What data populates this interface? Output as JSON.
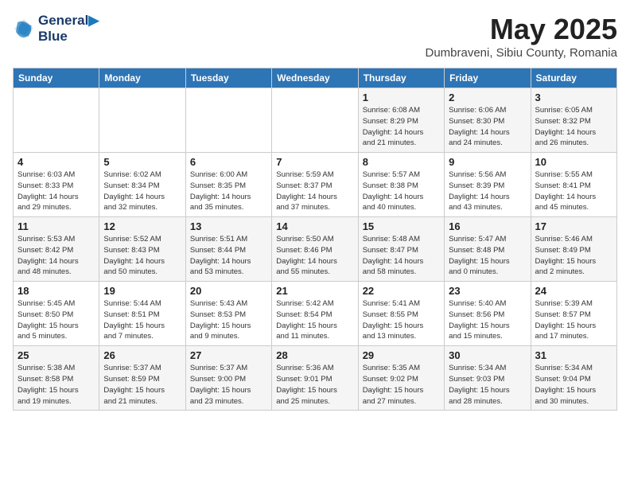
{
  "header": {
    "logo_line1": "General",
    "logo_line2": "Blue",
    "month": "May 2025",
    "location": "Dumbraveni, Sibiu County, Romania"
  },
  "weekdays": [
    "Sunday",
    "Monday",
    "Tuesday",
    "Wednesday",
    "Thursday",
    "Friday",
    "Saturday"
  ],
  "weeks": [
    [
      {
        "day": "",
        "info": ""
      },
      {
        "day": "",
        "info": ""
      },
      {
        "day": "",
        "info": ""
      },
      {
        "day": "",
        "info": ""
      },
      {
        "day": "1",
        "info": "Sunrise: 6:08 AM\nSunset: 8:29 PM\nDaylight: 14 hours\nand 21 minutes."
      },
      {
        "day": "2",
        "info": "Sunrise: 6:06 AM\nSunset: 8:30 PM\nDaylight: 14 hours\nand 24 minutes."
      },
      {
        "day": "3",
        "info": "Sunrise: 6:05 AM\nSunset: 8:32 PM\nDaylight: 14 hours\nand 26 minutes."
      }
    ],
    [
      {
        "day": "4",
        "info": "Sunrise: 6:03 AM\nSunset: 8:33 PM\nDaylight: 14 hours\nand 29 minutes."
      },
      {
        "day": "5",
        "info": "Sunrise: 6:02 AM\nSunset: 8:34 PM\nDaylight: 14 hours\nand 32 minutes."
      },
      {
        "day": "6",
        "info": "Sunrise: 6:00 AM\nSunset: 8:35 PM\nDaylight: 14 hours\nand 35 minutes."
      },
      {
        "day": "7",
        "info": "Sunrise: 5:59 AM\nSunset: 8:37 PM\nDaylight: 14 hours\nand 37 minutes."
      },
      {
        "day": "8",
        "info": "Sunrise: 5:57 AM\nSunset: 8:38 PM\nDaylight: 14 hours\nand 40 minutes."
      },
      {
        "day": "9",
        "info": "Sunrise: 5:56 AM\nSunset: 8:39 PM\nDaylight: 14 hours\nand 43 minutes."
      },
      {
        "day": "10",
        "info": "Sunrise: 5:55 AM\nSunset: 8:41 PM\nDaylight: 14 hours\nand 45 minutes."
      }
    ],
    [
      {
        "day": "11",
        "info": "Sunrise: 5:53 AM\nSunset: 8:42 PM\nDaylight: 14 hours\nand 48 minutes."
      },
      {
        "day": "12",
        "info": "Sunrise: 5:52 AM\nSunset: 8:43 PM\nDaylight: 14 hours\nand 50 minutes."
      },
      {
        "day": "13",
        "info": "Sunrise: 5:51 AM\nSunset: 8:44 PM\nDaylight: 14 hours\nand 53 minutes."
      },
      {
        "day": "14",
        "info": "Sunrise: 5:50 AM\nSunset: 8:46 PM\nDaylight: 14 hours\nand 55 minutes."
      },
      {
        "day": "15",
        "info": "Sunrise: 5:48 AM\nSunset: 8:47 PM\nDaylight: 14 hours\nand 58 minutes."
      },
      {
        "day": "16",
        "info": "Sunrise: 5:47 AM\nSunset: 8:48 PM\nDaylight: 15 hours\nand 0 minutes."
      },
      {
        "day": "17",
        "info": "Sunrise: 5:46 AM\nSunset: 8:49 PM\nDaylight: 15 hours\nand 2 minutes."
      }
    ],
    [
      {
        "day": "18",
        "info": "Sunrise: 5:45 AM\nSunset: 8:50 PM\nDaylight: 15 hours\nand 5 minutes."
      },
      {
        "day": "19",
        "info": "Sunrise: 5:44 AM\nSunset: 8:51 PM\nDaylight: 15 hours\nand 7 minutes."
      },
      {
        "day": "20",
        "info": "Sunrise: 5:43 AM\nSunset: 8:53 PM\nDaylight: 15 hours\nand 9 minutes."
      },
      {
        "day": "21",
        "info": "Sunrise: 5:42 AM\nSunset: 8:54 PM\nDaylight: 15 hours\nand 11 minutes."
      },
      {
        "day": "22",
        "info": "Sunrise: 5:41 AM\nSunset: 8:55 PM\nDaylight: 15 hours\nand 13 minutes."
      },
      {
        "day": "23",
        "info": "Sunrise: 5:40 AM\nSunset: 8:56 PM\nDaylight: 15 hours\nand 15 minutes."
      },
      {
        "day": "24",
        "info": "Sunrise: 5:39 AM\nSunset: 8:57 PM\nDaylight: 15 hours\nand 17 minutes."
      }
    ],
    [
      {
        "day": "25",
        "info": "Sunrise: 5:38 AM\nSunset: 8:58 PM\nDaylight: 15 hours\nand 19 minutes."
      },
      {
        "day": "26",
        "info": "Sunrise: 5:37 AM\nSunset: 8:59 PM\nDaylight: 15 hours\nand 21 minutes."
      },
      {
        "day": "27",
        "info": "Sunrise: 5:37 AM\nSunset: 9:00 PM\nDaylight: 15 hours\nand 23 minutes."
      },
      {
        "day": "28",
        "info": "Sunrise: 5:36 AM\nSunset: 9:01 PM\nDaylight: 15 hours\nand 25 minutes."
      },
      {
        "day": "29",
        "info": "Sunrise: 5:35 AM\nSunset: 9:02 PM\nDaylight: 15 hours\nand 27 minutes."
      },
      {
        "day": "30",
        "info": "Sunrise: 5:34 AM\nSunset: 9:03 PM\nDaylight: 15 hours\nand 28 minutes."
      },
      {
        "day": "31",
        "info": "Sunrise: 5:34 AM\nSunset: 9:04 PM\nDaylight: 15 hours\nand 30 minutes."
      }
    ]
  ]
}
